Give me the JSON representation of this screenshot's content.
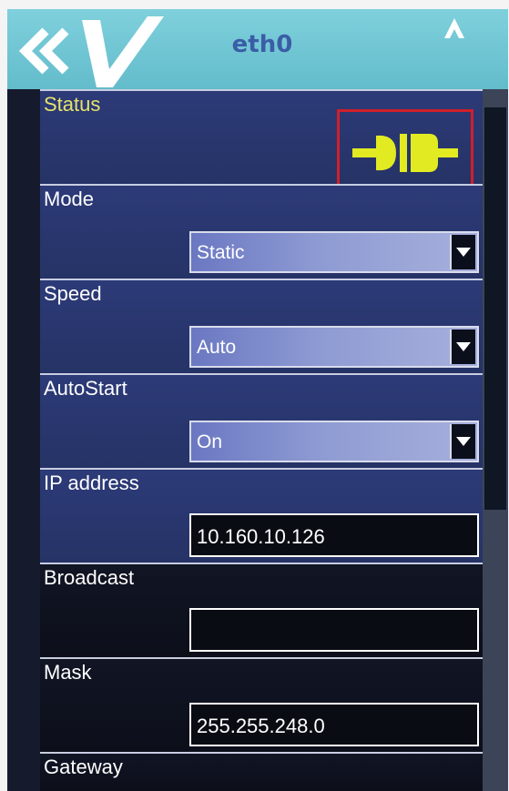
{
  "header": {
    "title": "eth0",
    "back_icon": "double-chevron-left-icon",
    "logo_icon": "v-logo-icon",
    "up_icon": "arrow-up-icon"
  },
  "fields": {
    "status": {
      "label": "Status",
      "icon": "plug-connected-icon",
      "icon_color": "#e2ea22",
      "highlight_color": "#d11f2a"
    },
    "mode": {
      "label": "Mode",
      "value": "Static"
    },
    "speed": {
      "label": "Speed",
      "value": "Auto"
    },
    "autostart": {
      "label": "AutoStart",
      "value": "On"
    },
    "ip_address": {
      "label": "IP address",
      "value": "10.160.10.126"
    },
    "broadcast": {
      "label": "Broadcast",
      "value": ""
    },
    "mask": {
      "label": "Mask",
      "value": "255.255.248.0"
    },
    "gateway": {
      "label": "Gateway"
    }
  },
  "colors": {
    "titlebar": "#6fc6d3",
    "title_text": "#3b5da6",
    "status_label": "#e6e36a"
  }
}
